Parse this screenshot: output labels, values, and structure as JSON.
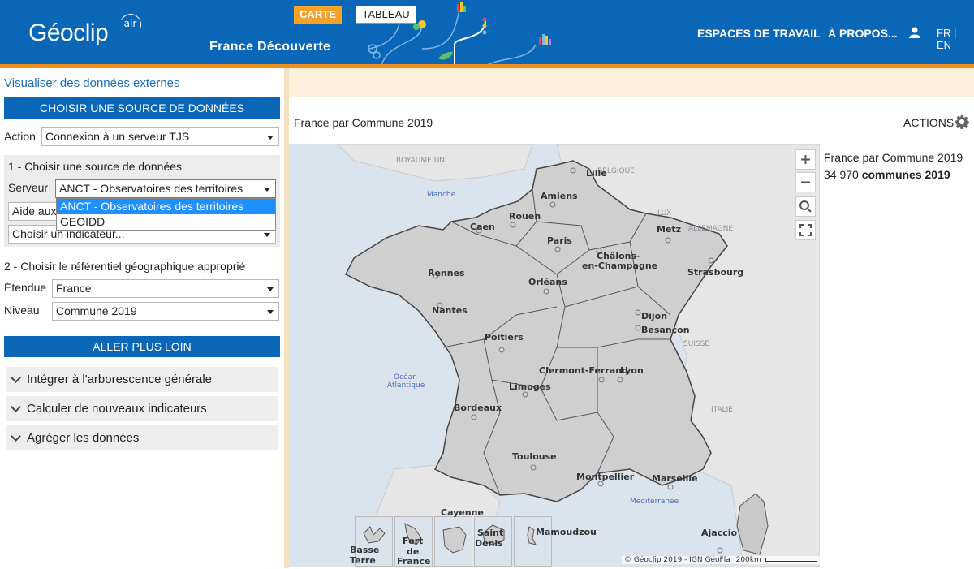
{
  "header": {
    "logo": "Géoclip",
    "logo_sup": "air",
    "site_title": "France Découverte",
    "nav_workspaces": "ESPACES DE TRAVAIL",
    "nav_about": "À PROPOS...",
    "lang_fr": "FR",
    "lang_sep": "|",
    "lang_en": "EN"
  },
  "sidebar": {
    "title": "Visualiser des données externes",
    "section_source": "CHOISIR UNE SOURCE DE DONNÉES",
    "action_label": "Action",
    "action_value": "Connexion à un serveur TJS",
    "step1_label": "1 - Choisir une source de données",
    "server_label": "Serveur",
    "server_value": "ANCT - Observatoires des territoires",
    "server_options": [
      "ANCT - Observatoires des territoires",
      "GEOIDD"
    ],
    "help_value": "Aide aux",
    "indicator_value": "Choisir un indicateur...",
    "step2_label": "2 - Choisir le référentiel géographique approprié",
    "extent_label": "Étendue",
    "extent_value": "France",
    "level_label": "Niveau",
    "level_value": "Commune 2019",
    "section_more": "ALLER PLUS LOIN",
    "accordions": [
      "Intégrer à l'arborescence générale",
      "Calculer de nouveaux indicateurs",
      "Agréger les données"
    ]
  },
  "tabs": {
    "map": "CARTE",
    "table": "TABLEAU"
  },
  "map": {
    "title": "France par Commune 2019",
    "actions": "ACTIONS",
    "legend_title": "France par Commune 2019",
    "legend_count": "34 970",
    "legend_unit": "communes 2019",
    "attribution": "© Géoclip 2019 - ",
    "attribution_link": "IGN GéoFla",
    "scale": "200km",
    "cities": [
      "Lille",
      "Amiens",
      "Rouen",
      "Caen",
      "Paris",
      "Metz",
      "Châlons-",
      "en-Champagne",
      "Strasbourg",
      "Rennes",
      "Orléans",
      "Nantes",
      "Dijon",
      "Besançon",
      "Poitiers",
      "Clermont-Ferrand",
      "Lyon",
      "Limoges",
      "Bordeaux",
      "Toulouse",
      "Montpellier",
      "Marseille",
      "Ajaccio"
    ],
    "countries": [
      "ROYAUME UNI",
      "BELGIQUE",
      "LUX",
      "ALLEMAGNE",
      "SUISSE",
      "ITALIE"
    ],
    "seas": [
      "Manche",
      "Océan",
      "Atlantique",
      "Méditerranée"
    ],
    "insets": [
      [
        "Basse",
        "Terre"
      ],
      [
        "Fort",
        "de",
        "France"
      ],
      [
        "Cayenne"
      ],
      [
        "Saint",
        "Denis"
      ],
      [
        "Mamoudzou"
      ]
    ]
  },
  "colors": {
    "brand_blue": "#0a67b8",
    "accent_orange": "#f18e1c",
    "tab_orange": "#f6a128"
  }
}
